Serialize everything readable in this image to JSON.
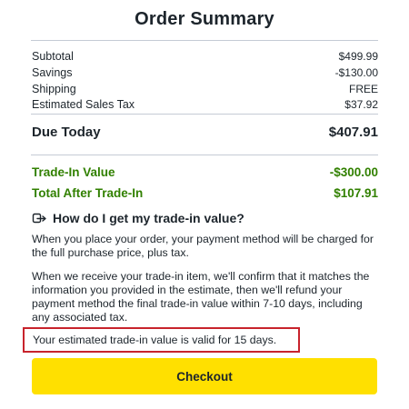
{
  "title": "Order Summary",
  "summary": [
    {
      "label": "Subtotal",
      "value": "$499.99"
    },
    {
      "label": "Savings",
      "value": "-$130.00"
    },
    {
      "label": "Shipping",
      "value": "FREE"
    },
    {
      "label": "Estimated Sales Tax",
      "value": "$37.92"
    }
  ],
  "due_today": {
    "label": "Due Today",
    "value": "$407.91"
  },
  "trade_in_value": {
    "label": "Trade-In Value",
    "value": "-$300.00"
  },
  "total_after_trade_in": {
    "label": "Total After Trade-In",
    "value": "$107.91"
  },
  "faq": {
    "icon": "trade-in-swap-icon",
    "question": "How do I get my trade-in value?",
    "paragraph1": "When you place your order, your payment method will be charged for the full purchase price, plus tax.",
    "paragraph2": "When we receive your trade-in item, we'll confirm that it matches the information you provided in the estimate, then we'll refund your payment method the final trade-in value within 7-10 days, including any associated tax."
  },
  "validity_note": "Your estimated trade-in value is valid for 15 days.",
  "checkout_label": "Checkout",
  "colors": {
    "green": "#318000",
    "button": "#ffe000",
    "highlight_border": "#c8232c",
    "text": "#1d252c"
  }
}
